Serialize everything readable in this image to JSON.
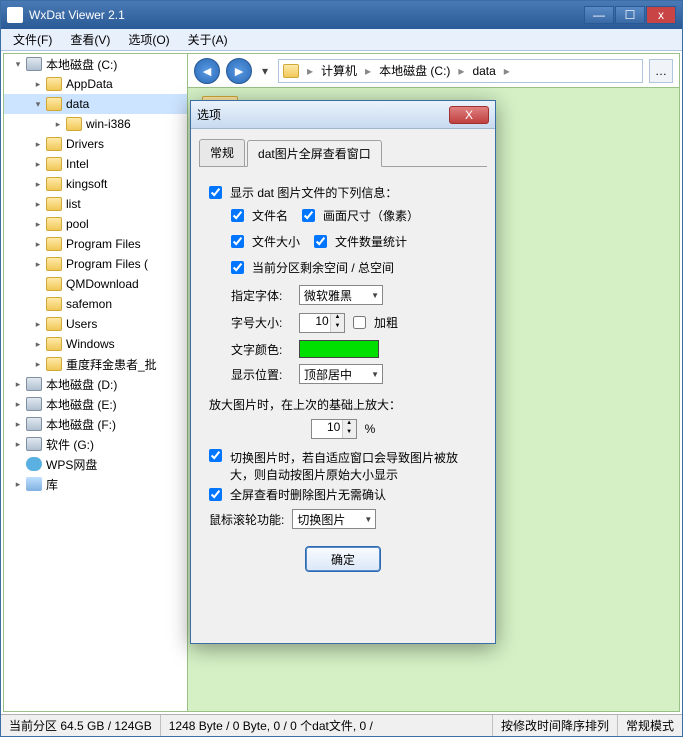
{
  "app": {
    "title": "WxDat Viewer 2.1"
  },
  "win_controls": {
    "min": "—",
    "max": "☐",
    "close": "x"
  },
  "menubar": [
    {
      "label": "文件(F)"
    },
    {
      "label": "查看(V)"
    },
    {
      "label": "选项(O)"
    },
    {
      "label": "关于(A)"
    }
  ],
  "nav": {
    "back": "◄",
    "fwd": "►",
    "dd": "▾",
    "extra": "…"
  },
  "breadcrumb": [
    {
      "label": "计算机"
    },
    {
      "label": "本地磁盘 (C:)"
    },
    {
      "label": "data"
    }
  ],
  "tree": [
    {
      "label": "本地磁盘 (C:)",
      "indent": 0,
      "icon": "drive",
      "exp": "▾"
    },
    {
      "label": "AppData",
      "indent": 1,
      "icon": "folder",
      "exp": "▸"
    },
    {
      "label": "data",
      "indent": 1,
      "icon": "folder",
      "exp": "▾",
      "selected": true
    },
    {
      "label": "win-i386",
      "indent": 2,
      "icon": "folder",
      "exp": "▸"
    },
    {
      "label": "Drivers",
      "indent": 1,
      "icon": "folder",
      "exp": "▸"
    },
    {
      "label": "Intel",
      "indent": 1,
      "icon": "folder",
      "exp": "▸"
    },
    {
      "label": "kingsoft",
      "indent": 1,
      "icon": "folder",
      "exp": "▸"
    },
    {
      "label": "list",
      "indent": 1,
      "icon": "folder",
      "exp": "▸"
    },
    {
      "label": "pool",
      "indent": 1,
      "icon": "folder",
      "exp": "▸"
    },
    {
      "label": "Program Files",
      "indent": 1,
      "icon": "folder",
      "exp": "▸"
    },
    {
      "label": "Program Files (",
      "indent": 1,
      "icon": "folder",
      "exp": "▸"
    },
    {
      "label": "QMDownload",
      "indent": 1,
      "icon": "folder",
      "exp": ""
    },
    {
      "label": "safemon",
      "indent": 1,
      "icon": "folder",
      "exp": ""
    },
    {
      "label": "Users",
      "indent": 1,
      "icon": "folder",
      "exp": "▸"
    },
    {
      "label": "Windows",
      "indent": 1,
      "icon": "folder",
      "exp": "▸"
    },
    {
      "label": "重度拜金患者_批",
      "indent": 1,
      "icon": "folder",
      "exp": "▸"
    },
    {
      "label": "本地磁盘 (D:)",
      "indent": 0,
      "icon": "drive",
      "exp": "▸"
    },
    {
      "label": "本地磁盘 (E:)",
      "indent": 0,
      "icon": "drive",
      "exp": "▸"
    },
    {
      "label": "本地磁盘 (F:)",
      "indent": 0,
      "icon": "drive",
      "exp": "▸"
    },
    {
      "label": "软件 (G:)",
      "indent": 0,
      "icon": "drive",
      "exp": "▸"
    },
    {
      "label": "WPS网盘",
      "indent": 0,
      "icon": "cloud",
      "exp": ""
    },
    {
      "label": "库",
      "indent": 0,
      "icon": "lib",
      "exp": "▸"
    }
  ],
  "status": {
    "seg1": "当前分区  64.5 GB / 124GB",
    "seg2": "1248 Byte / 0 Byte,  0 / 0 个dat文件,  0 /",
    "seg3": "按修改时间降序排列",
    "seg4": "常规模式"
  },
  "dialog": {
    "title": "选项",
    "tabs": {
      "tab1": "常规",
      "tab2": "dat图片全屏查看窗口"
    },
    "header": "显示 dat 图片文件的下列信息：",
    "chk_filename": "文件名",
    "chk_imgsize": "画面尺寸（像素）",
    "chk_filesize": "文件大小",
    "chk_filecount": "文件数量统计",
    "chk_partition": "当前分区剩余空间 / 总空间",
    "lbl_font": "指定字体:",
    "val_font": "微软雅黑",
    "lbl_fontsize": "字号大小:",
    "val_fontsize": "10",
    "chk_bold": "加粗",
    "lbl_color": "文字颜色:",
    "val_color": "#00e000",
    "lbl_pos": "显示位置:",
    "val_pos": "顶部居中",
    "lbl_zoom_section": "放大图片时，在上次的基础上放大：",
    "val_zoom": "10",
    "zoom_suffix": "%",
    "chk_switch": "切换图片时，若自适应窗口会导致图片被放大，则自动按图片原始大小显示",
    "chk_delete": "全屏查看时删除图片无需确认",
    "lbl_wheel": "鼠标滚轮功能:",
    "val_wheel": "切换图片",
    "ok": "确定"
  }
}
